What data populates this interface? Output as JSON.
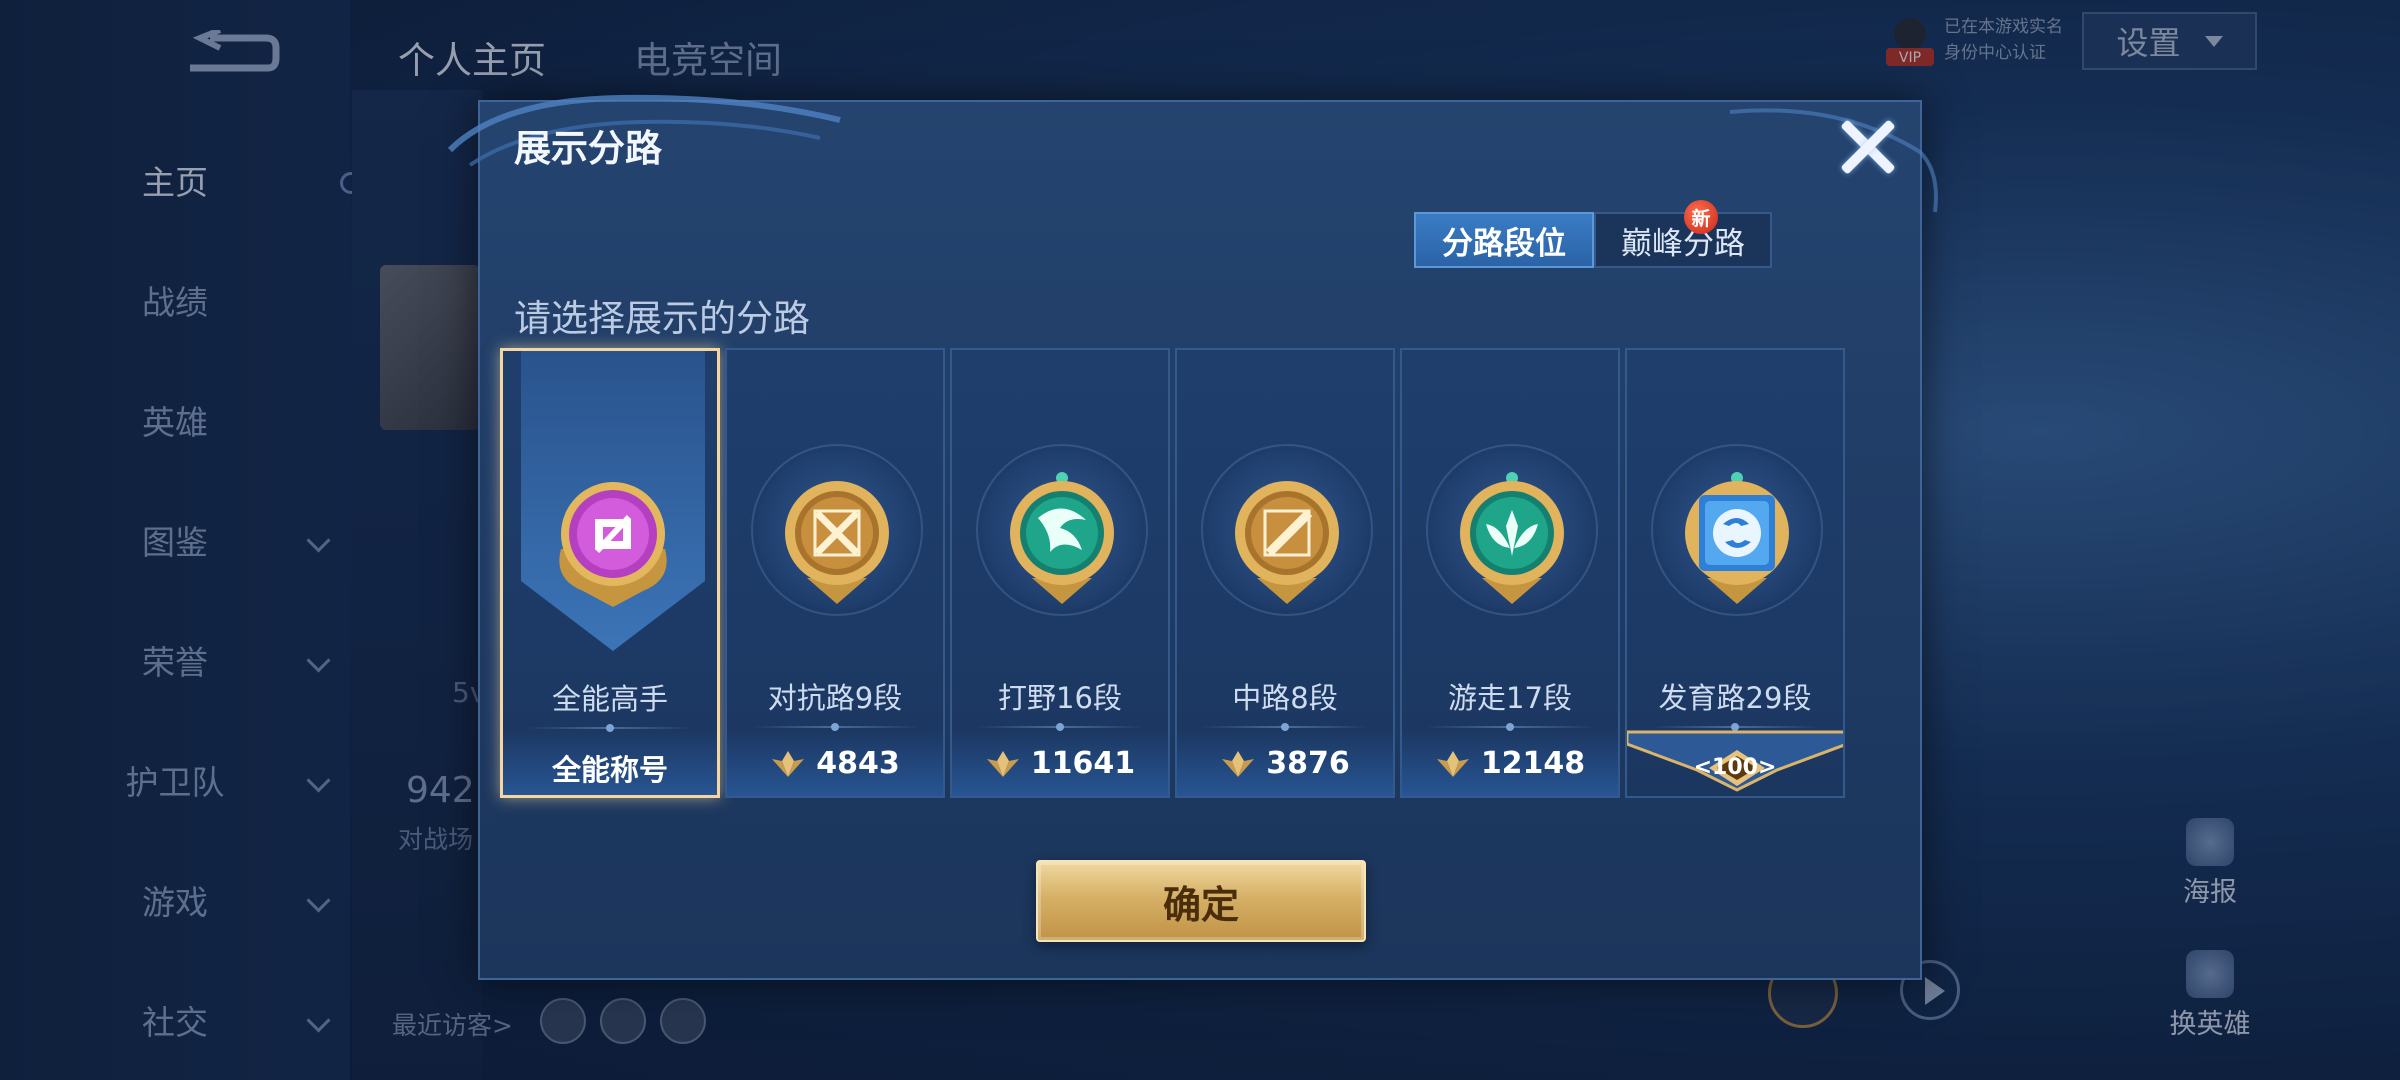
{
  "top_tabs": [
    "个人主页",
    "电竞空间"
  ],
  "sidebar": {
    "items": [
      {
        "label": "主页",
        "has_chevron": false
      },
      {
        "label": "战绩",
        "has_chevron": false
      },
      {
        "label": "英雄",
        "has_chevron": false
      },
      {
        "label": "图鉴",
        "has_chevron": true
      },
      {
        "label": "荣誉",
        "has_chevron": true
      },
      {
        "label": "护卫队",
        "has_chevron": true
      },
      {
        "label": "游戏",
        "has_chevron": true
      },
      {
        "label": "社交",
        "has_chevron": true
      }
    ]
  },
  "background": {
    "partial_num": "942",
    "partial_label": "对战场",
    "partial_small": "5v",
    "visitors_label": "最近访客>",
    "settings_label": "设置",
    "vip_line1": "已在本游戏实名",
    "vip_line2": "身份中心认证",
    "right_icons": [
      "海报",
      "换英雄"
    ]
  },
  "modal": {
    "title": "展示分路",
    "tabs": [
      "分路段位",
      "巅峰分路"
    ],
    "new_badge": "新",
    "prompt": "请选择展示的分路",
    "confirm_label": "确定",
    "cards": [
      {
        "rank": "全能高手",
        "footer_text": "全能称号",
        "type": "title",
        "selected": true,
        "emblem": "all-round-emblem-icon"
      },
      {
        "rank": "对抗路9段",
        "points": "4843",
        "type": "points",
        "selected": false,
        "emblem": "clash-lane-emblem-icon"
      },
      {
        "rank": "打野16段",
        "points": "11641",
        "type": "points",
        "selected": false,
        "emblem": "jungle-emblem-icon"
      },
      {
        "rank": "中路8段",
        "points": "3876",
        "type": "points",
        "selected": false,
        "emblem": "mid-lane-emblem-icon"
      },
      {
        "rank": "游走17段",
        "points": "12148",
        "type": "points",
        "selected": false,
        "emblem": "roam-emblem-icon"
      },
      {
        "rank": "发育路29段",
        "peak_value": "100",
        "type": "peak",
        "selected": false,
        "emblem": "farm-lane-emblem-icon"
      }
    ]
  },
  "colors": {
    "gold": "#d6b066",
    "panel": "#24446f",
    "active_tab": "#3a7cc4",
    "new_badge": "#c8281d"
  }
}
